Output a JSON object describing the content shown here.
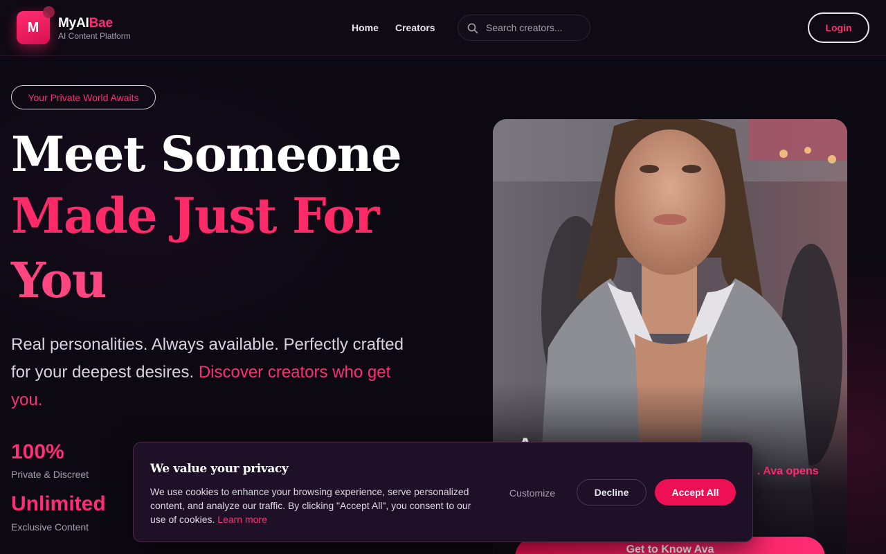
{
  "brand": {
    "logo_letter": "M",
    "name_part1": "MyAI",
    "name_part2": "Bae",
    "subtitle": "AI Content Platform",
    "accent_color": "#ff2d74"
  },
  "nav": {
    "items": [
      {
        "label": "Home"
      },
      {
        "label": "Creators"
      }
    ],
    "search_placeholder": "Search creators...",
    "login_label": "Login"
  },
  "hero": {
    "pill": "Your Private World Awaits",
    "headline_line1": "Meet Someone",
    "headline_line2": "Made Just For",
    "headline_line3": "You",
    "description": "Real personalities. Always available. Perfectly crafted for your deepest desires. ",
    "description_highlight": "Discover creators who get you.",
    "stats": [
      {
        "value": "100%",
        "label": "Private & Discreet"
      },
      {
        "value": "Unlimited",
        "label": "Exclusive Content"
      }
    ]
  },
  "featured": {
    "name": "A",
    "text_visible": ". Ava opens",
    "button_label": "Get to Know Ava"
  },
  "cookie": {
    "title": "We value your privacy",
    "text": "We use cookies to enhance your browsing experience, serve personalized content, and analyze our traffic. By clicking \"Accept All\", you consent to our use of cookies. ",
    "learn_more": "Learn more",
    "customize_label": "Customize",
    "decline_label": "Decline",
    "accept_label": "Accept All"
  }
}
